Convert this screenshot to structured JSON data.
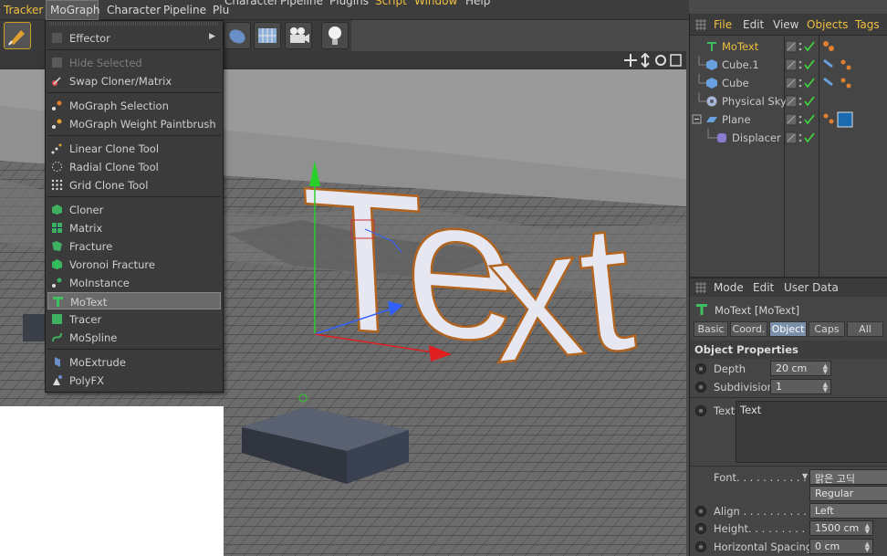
{
  "menubar": {
    "items": [
      "Tracker",
      "MoGraph",
      "Character",
      "Pipeline",
      "Plu"
    ],
    "background_items": [
      "Character",
      "Pipeline",
      "Plugins",
      "Script",
      "Window",
      "Help"
    ]
  },
  "mograph_menu": {
    "items": [
      {
        "label": "Effector",
        "icon": "effector-icon",
        "submenu": true
      },
      {
        "label": "Hide Selected",
        "icon": "hide-icon",
        "disabled": true
      },
      {
        "label": "Swap Cloner/Matrix",
        "icon": "swap-icon"
      },
      {
        "label": "MoGraph Selection",
        "icon": "selection-icon"
      },
      {
        "label": "MoGraph Weight Paintbrush",
        "icon": "paintbrush-icon"
      },
      {
        "label": "Linear Clone Tool",
        "icon": "linear-clone-icon"
      },
      {
        "label": "Radial Clone Tool",
        "icon": "radial-clone-icon"
      },
      {
        "label": "Grid Clone Tool",
        "icon": "grid-clone-icon"
      },
      {
        "label": "Cloner",
        "icon": "cloner-icon"
      },
      {
        "label": "Matrix",
        "icon": "matrix-icon"
      },
      {
        "label": "Fracture",
        "icon": "fracture-icon"
      },
      {
        "label": "Voronoi Fracture",
        "icon": "voronoi-icon"
      },
      {
        "label": "MoInstance",
        "icon": "moinstance-icon"
      },
      {
        "label": "MoText",
        "icon": "motext-icon",
        "selected": true
      },
      {
        "label": "Tracer",
        "icon": "tracer-icon"
      },
      {
        "label": "MoSpline",
        "icon": "mospline-icon"
      },
      {
        "label": "MoExtrude",
        "icon": "moextrude-icon"
      },
      {
        "label": "PolyFX",
        "icon": "polyfx-icon"
      }
    ]
  },
  "object_manager": {
    "menu": [
      "File",
      "Edit",
      "View",
      "Objects",
      "Tags"
    ],
    "objects": [
      {
        "name": "MoText",
        "icon": "motext-icon",
        "selected": true
      },
      {
        "name": "Cube.1",
        "icon": "cube-icon"
      },
      {
        "name": "Cube",
        "icon": "cube-icon"
      },
      {
        "name": "Physical Sky",
        "icon": "sky-icon"
      },
      {
        "name": "Plane",
        "icon": "plane-icon"
      },
      {
        "name": "Displacer",
        "icon": "displacer-icon"
      }
    ]
  },
  "attributes": {
    "menu": [
      "Mode",
      "Edit",
      "User Data"
    ],
    "object_title": "MoText [MoText]",
    "tabs": [
      "Basic",
      "Coord.",
      "Object",
      "Caps",
      "All"
    ],
    "active_tab": "Object",
    "section": "Object Properties",
    "depth_label": "Depth",
    "depth_value": "20 cm",
    "subdivision_label": "Subdivision",
    "subdivision_value": "1",
    "text_label": "Text",
    "text_value": "Text",
    "font_label": "Font. . . . . . . . . . . . .",
    "font_value": "맑은 고딕",
    "style_value": "Regular",
    "align_label": "Align . . . . . . . . . . . .",
    "align_value": "Left",
    "height_label": "Height. . . . . . . . . . . .",
    "height_value": "1500 cm",
    "hspacing_label": "Horizontal Spacing",
    "hspacing_value": "0 cm"
  },
  "viewport": {
    "text3d": "Text"
  },
  "colors": {
    "accent": "#f0c040",
    "selected_tab": "#7a8fa8",
    "check_green": "#3fcf3f"
  }
}
